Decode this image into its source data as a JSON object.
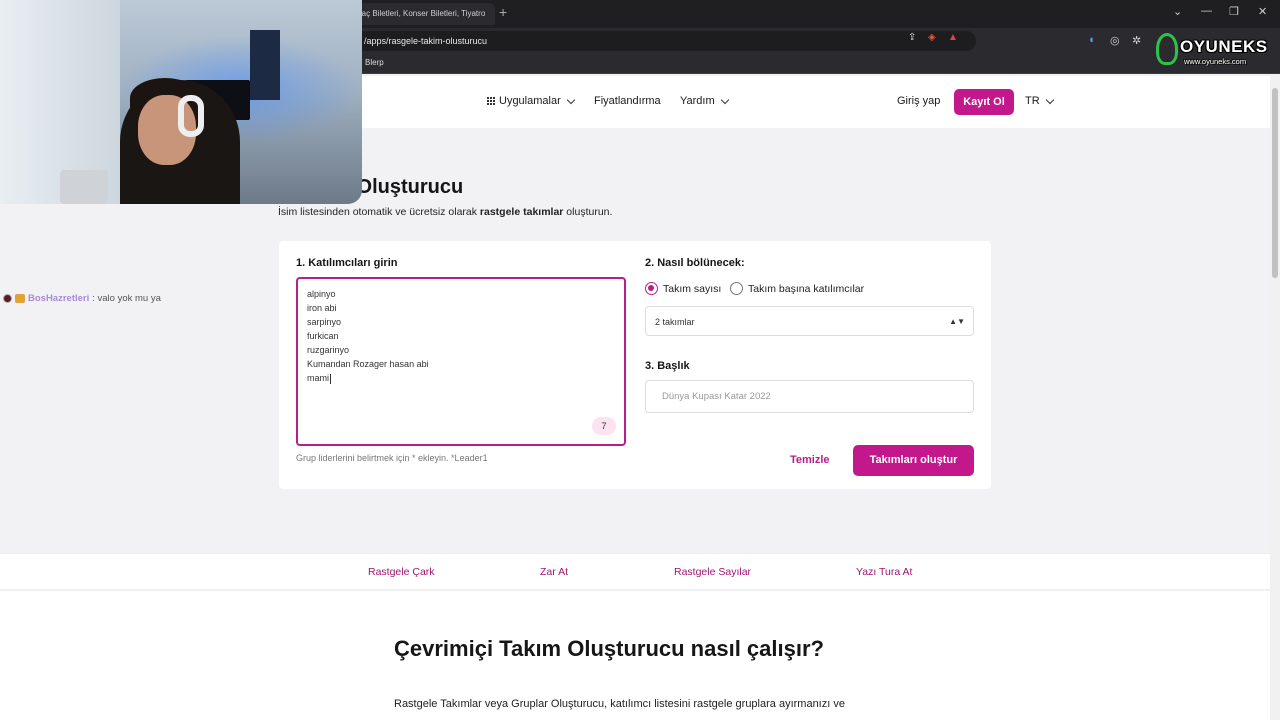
{
  "browser": {
    "tab_title": "Maç Biletleri, Konser Biletleri, Tiyatro",
    "new_tab": "+",
    "url": "/apps/rasgele-takim-olusturucu",
    "bookmark": "Blerp",
    "window_controls": [
      "⌄",
      "—",
      "❐",
      "✕"
    ]
  },
  "nav": {
    "apps": "Uygulamalar",
    "pricing": "Fiyatlandırma",
    "help": "Yardım",
    "login": "Giriş yap",
    "signup": "Kayıt Ol",
    "lang": "TR"
  },
  "main": {
    "title": "e Takım Oluşturucu",
    "subtitle_pre": "İsim listesinden otomatik ve ücretsiz olarak ",
    "subtitle_bold": "rastgele takımlar",
    "subtitle_post": " oluşturun."
  },
  "form": {
    "participants_label": "1. Katılımcıları girin",
    "participants": [
      "alpinyo",
      "iron abi",
      "sarpinyo",
      "furkican",
      "ruzgarinyo",
      "Kumandan Rozager hasan abi",
      "mami"
    ],
    "count": "7",
    "hint": "Grup liderlerini belirtmek için * ekleyin. *Leader1",
    "split_label": "2. Nasıl bölünecek:",
    "radio_team_count": "Takım sayısı",
    "radio_per_team": "Takım başına katılımcılar",
    "select_value": "2 takımlar",
    "title_label": "3. Başlık",
    "title_placeholder": "Dünya Kupası Katar 2022",
    "clear_button": "Temizle",
    "create_button": "Takımları oluştur"
  },
  "links": [
    "Rastgele Çark",
    "Zar At",
    "Rastgele Sayılar",
    "Yazı Tura At"
  ],
  "info": {
    "heading": "Çevrimiçi Takım Oluşturucu nasıl çalışır?",
    "paragraph": "Rastgele Takımlar veya Gruplar Oluşturucu, katılımcı listesini rastgele gruplara ayırmanızı ve"
  },
  "overlay": {
    "chat_user": "BosHazretleri",
    "chat_message": " : valo yok mu ya",
    "logo_text": "OYUNEKS",
    "logo_sub": "www.oyuneks.com"
  },
  "colors": {
    "accent": "#c2188c",
    "link": "#a0156f"
  }
}
